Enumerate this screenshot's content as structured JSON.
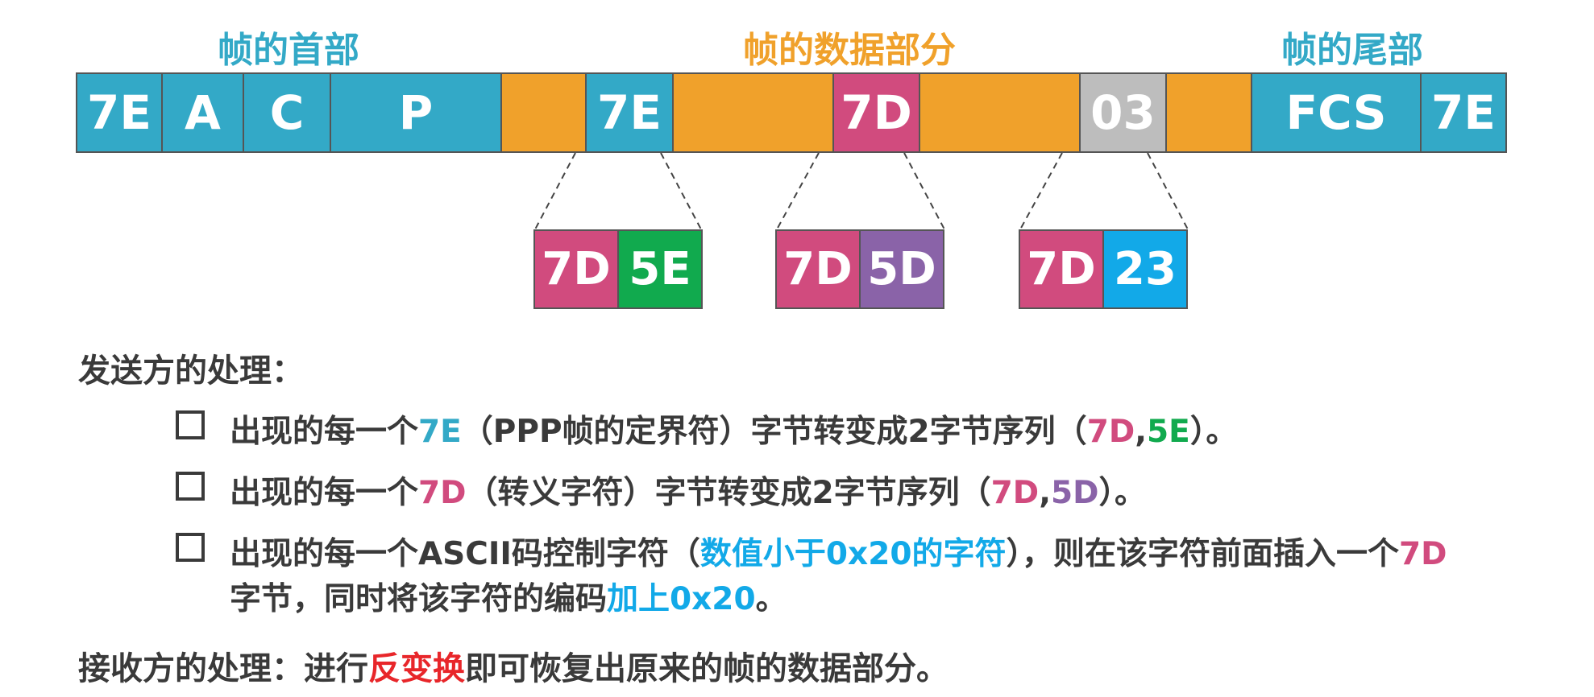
{
  "colors": {
    "teal": "#33A9C7",
    "orange": "#F0A12B",
    "magenta": "#D14B7E",
    "gray": "#BDBDBD",
    "green": "#11AA4E",
    "purple": "#8A63A8",
    "skyblue": "#12A9E8",
    "red": "#E8262A",
    "text": "#3a3a3a"
  },
  "headers": {
    "frame_head": "帧的首部",
    "frame_data": "帧的数据部分",
    "frame_tail": "帧的尾部"
  },
  "frame_segments": [
    {
      "label": "7E",
      "kind": "header"
    },
    {
      "label": "A",
      "kind": "header"
    },
    {
      "label": "C",
      "kind": "header"
    },
    {
      "label": "P",
      "kind": "header"
    },
    {
      "label": "",
      "kind": "data"
    },
    {
      "label": "7E",
      "kind": "header"
    },
    {
      "label": "",
      "kind": "data"
    },
    {
      "label": "7D",
      "kind": "escape"
    },
    {
      "label": "",
      "kind": "data"
    },
    {
      "label": "03",
      "kind": "control"
    },
    {
      "label": "",
      "kind": "data"
    },
    {
      "label": "FCS",
      "kind": "header"
    },
    {
      "label": "7E",
      "kind": "header"
    }
  ],
  "expansions": [
    {
      "first": "7D",
      "second": "5E",
      "second_color": "green"
    },
    {
      "first": "7D",
      "second": "5D",
      "second_color": "purple"
    },
    {
      "first": "7D",
      "second": "23",
      "second_color": "skyblue"
    }
  ],
  "sender": {
    "title": "发送方的处理：",
    "rule1": {
      "prefix": "出现的每一个",
      "byte": "7E",
      "middle": "（PPP帧的定界符）字节转变成2字节序列（",
      "seq_a": "7D",
      "comma": ",",
      "seq_b": "5E",
      "suffix": "）。"
    },
    "rule2": {
      "prefix": "出现的每一个",
      "byte": "7D",
      "middle": "（转义字符）字节转变成2字节序列（",
      "seq_a": "7D",
      "comma": ",",
      "seq_b": "5D",
      "suffix": "）。"
    },
    "rule3": {
      "prefix": "出现的每一个ASCII码控制字符（",
      "highlight": "数值小于0x20的字符",
      "middle": "），则在该字符前面插入一个",
      "byte": "7D",
      "line2_prefix": "字节，同时将该字符的编码",
      "line2_highlight": "加上0x20",
      "line2_suffix": "。"
    }
  },
  "receiver": {
    "title": "接收方的处理：",
    "prefix": "进行",
    "highlight": "反变换",
    "suffix": "即可恢复出原来的帧的数据部分。"
  }
}
